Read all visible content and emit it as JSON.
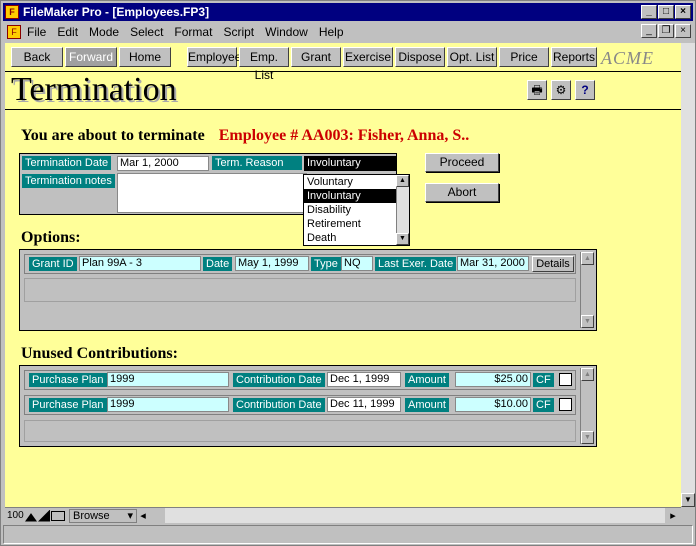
{
  "window": {
    "title": "FileMaker Pro - [Employees.FP3]",
    "app_icon": "filemaker-icon"
  },
  "menu": {
    "items": [
      "File",
      "Edit",
      "Mode",
      "Select",
      "Format",
      "Script",
      "Window",
      "Help"
    ]
  },
  "nav": {
    "buttons": [
      "Back",
      "Forward",
      "Home",
      "Employee",
      "Emp. List",
      "Grant",
      "Exercise",
      "Dispose",
      "Opt. List",
      "Price",
      "Reports"
    ],
    "logo": "ACME"
  },
  "page": {
    "title": "Termination",
    "warning_prefix": "You are about to terminate",
    "employee_ref": "Employee # AA003: Fisher, Anna, S.."
  },
  "form": {
    "termination_date_label": "Termination Date",
    "termination_date_value": "Mar 1, 2000",
    "term_reason_label": "Term. Reason",
    "term_reason_value": "Involuntary",
    "notes_label": "Termination notes",
    "proceed_label": "Proceed",
    "abort_label": "Abort",
    "reason_options": [
      "Voluntary",
      "Involuntary",
      "Disability",
      "Retirement",
      "Death"
    ],
    "reason_selected": "Involuntary"
  },
  "options": {
    "heading": "Options:",
    "row": {
      "grant_id_label": "Grant ID",
      "grant_id_value": "Plan 99A - 3",
      "date_label": "Date",
      "date_value": "May 1, 1999",
      "type_label": "Type",
      "type_value": "NQ",
      "last_exer_label": "Last Exer. Date",
      "last_exer_value": "Mar 31, 2000",
      "details_label": "Details"
    }
  },
  "contributions": {
    "heading": "Unused Contributions:",
    "rows": [
      {
        "plan_label": "Purchase Plan",
        "plan_value": "1999",
        "date_label": "Contribution Date",
        "date_value": "Dec 1, 1999",
        "amount_label": "Amount",
        "amount_value": "$25.00",
        "cf_label": "CF"
      },
      {
        "plan_label": "Purchase Plan",
        "plan_value": "1999",
        "date_label": "Contribution Date",
        "date_value": "Dec 11, 1999",
        "amount_label": "Amount",
        "amount_value": "$10.00",
        "cf_label": "CF"
      }
    ]
  },
  "status": {
    "zoom": "100",
    "mode": "Browse"
  }
}
